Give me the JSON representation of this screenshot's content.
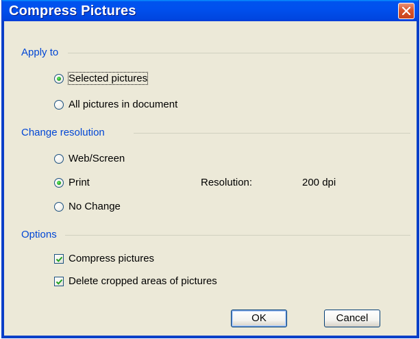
{
  "window": {
    "title": "Compress Pictures",
    "close_icon": "close-icon"
  },
  "apply_to": {
    "heading": "Apply to",
    "options": [
      {
        "label": "Selected pictures",
        "checked": true
      },
      {
        "label": "All pictures in document",
        "checked": false
      }
    ]
  },
  "resolution": {
    "heading": "Change resolution",
    "options": [
      {
        "label": "Web/Screen",
        "checked": false
      },
      {
        "label": "Print",
        "checked": true
      },
      {
        "label": "No Change",
        "checked": false
      }
    ],
    "info_label": "Resolution:",
    "info_value": "200 dpi"
  },
  "options": {
    "heading": "Options",
    "checkboxes": [
      {
        "label": "Compress pictures",
        "checked": true
      },
      {
        "label": "Delete cropped areas of pictures",
        "checked": true
      }
    ]
  },
  "buttons": {
    "ok": "OK",
    "cancel": "Cancel"
  },
  "colors": {
    "title_bar": "#0053ee",
    "section_heading": "#0046d5",
    "radio_selected": "#21a121",
    "check_mark": "#21a121"
  }
}
